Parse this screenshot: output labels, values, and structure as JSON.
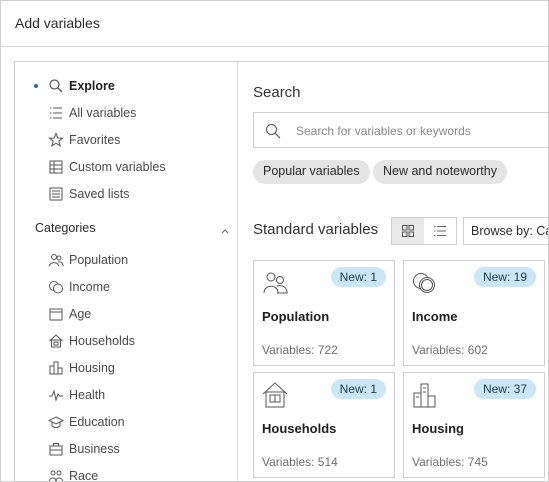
{
  "dialog": {
    "title": "Add variables"
  },
  "nav": [
    {
      "label": "Explore",
      "icon": "search-icon"
    },
    {
      "label": "All variables",
      "icon": "list-icon"
    },
    {
      "label": "Favorites",
      "icon": "star-icon"
    },
    {
      "label": "Custom variables",
      "icon": "custom-variables-icon"
    },
    {
      "label": "Saved lists",
      "icon": "saved-lists-icon"
    }
  ],
  "categories": {
    "header": "Categories",
    "items": [
      {
        "label": "Population",
        "icon": "people-icon"
      },
      {
        "label": "Income",
        "icon": "coins-icon"
      },
      {
        "label": "Age",
        "icon": "calendar-icon"
      },
      {
        "label": "Households",
        "icon": "house-icon"
      },
      {
        "label": "Housing",
        "icon": "buildings-icon"
      },
      {
        "label": "Health",
        "icon": "heartbeat-icon"
      },
      {
        "label": "Education",
        "icon": "graduation-cap-icon"
      },
      {
        "label": "Business",
        "icon": "business-icon"
      },
      {
        "label": "Race",
        "icon": "race-icon"
      }
    ]
  },
  "search": {
    "label": "Search",
    "placeholder": "Search for variables or keywords",
    "chips": [
      "Popular variables",
      "New and noteworthy"
    ]
  },
  "standard": {
    "label": "Standard variables",
    "browse_label": "Browse by:  Ca"
  },
  "cards": [
    {
      "title": "Population",
      "badge": "New: 1",
      "count": "Variables: 722",
      "icon": "people-icon"
    },
    {
      "title": "Income",
      "badge": "New: 19",
      "count": "Variables: 602",
      "icon": "coins-icon"
    },
    {
      "title": "Households",
      "badge": "New: 1",
      "count": "Variables: 514",
      "icon": "house-icon"
    },
    {
      "title": "Housing",
      "badge": "New: 37",
      "count": "Variables: 745",
      "icon": "buildings-icon"
    }
  ],
  "colors": {
    "badge_bg": "#c9e7f6",
    "chip_bg": "#e4e4e4",
    "active_dot": "#2a6f97"
  }
}
